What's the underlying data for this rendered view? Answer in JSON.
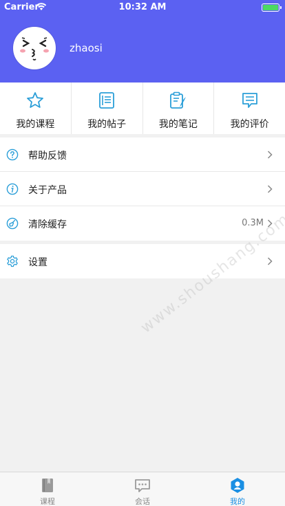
{
  "status_bar": {
    "carrier": "Carrier",
    "time": "10:32 AM",
    "battery_level": 1.0
  },
  "profile": {
    "username": "zhaosi"
  },
  "quick_actions": [
    {
      "label": "我的课程",
      "icon": "star-icon"
    },
    {
      "label": "我的帖子",
      "icon": "document-icon"
    },
    {
      "label": "我的笔记",
      "icon": "clipboard-pen-icon"
    },
    {
      "label": "我的评价",
      "icon": "comment-icon"
    }
  ],
  "menu": [
    {
      "label": "帮助反馈",
      "icon": "help-circle-icon",
      "value": ""
    },
    {
      "label": "关于产品",
      "icon": "info-circle-icon",
      "value": ""
    },
    {
      "label": "清除缓存",
      "icon": "broom-icon",
      "value": "0.3M"
    }
  ],
  "settings": {
    "label": "设置",
    "icon": "gear-icon"
  },
  "tabbar": [
    {
      "label": "课程",
      "icon": "book-icon",
      "active": false
    },
    {
      "label": "会话",
      "icon": "chat-icon",
      "active": false
    },
    {
      "label": "我的",
      "icon": "hexagon-user-icon",
      "active": true
    }
  ],
  "watermark": "www.shoushang.com",
  "colors": {
    "header": "#5b61f2",
    "accent": "#1a8fe3",
    "icon": "#2a9ed8"
  }
}
